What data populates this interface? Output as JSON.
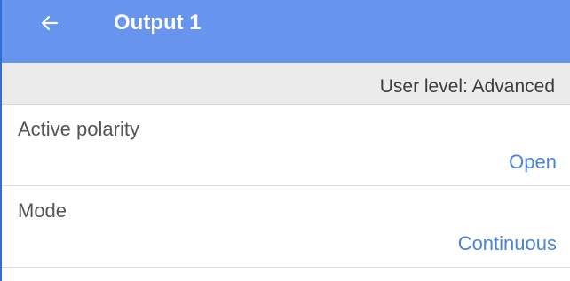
{
  "app_bar": {
    "title": "Output 1",
    "back_icon": "arrow-left-icon",
    "background_color": "#6694ee"
  },
  "user_level": {
    "text": "User level: Advanced"
  },
  "settings": [
    {
      "label": "Active polarity",
      "value": "Open"
    },
    {
      "label": "Mode",
      "value": "Continuous"
    }
  ],
  "colors": {
    "value_text": "#4a84d6",
    "label_text": "#555555",
    "user_level_bg": "#ebebeb"
  }
}
